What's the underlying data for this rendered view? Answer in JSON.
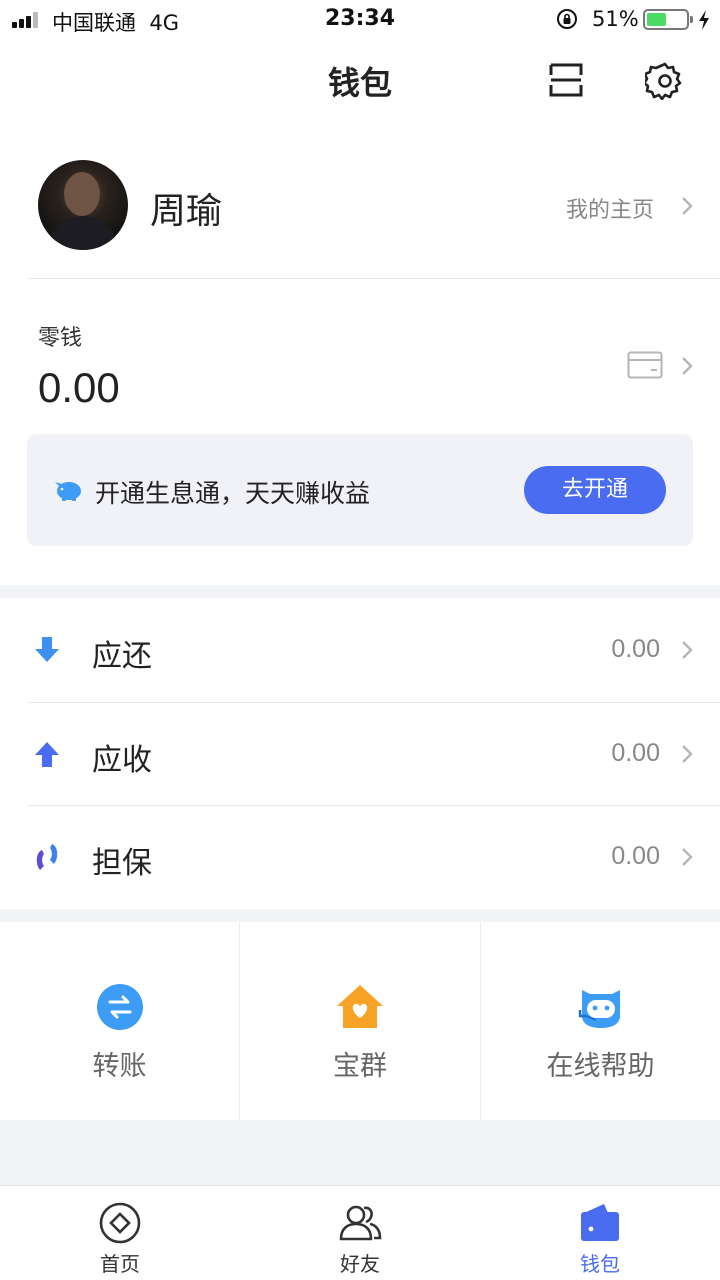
{
  "status_bar": {
    "carrier": "中国联通",
    "network": "4G",
    "time": "23:34",
    "battery_percent": "51%",
    "battery_level": 0.51
  },
  "nav": {
    "title": "钱包",
    "scan_icon": "scan-icon",
    "settings_icon": "gear-icon"
  },
  "profile": {
    "name": "周瑜",
    "homepage_link": "我的主页"
  },
  "balance": {
    "label": "零钱",
    "amount": "0.00",
    "card_icon": "bank-card-icon"
  },
  "promo": {
    "text": "开通生息通，天天赚收益",
    "button": "去开通",
    "icon": "piggy-bank-icon"
  },
  "rows": [
    {
      "label": "应还",
      "value": "0.00",
      "icon": "arrow-down-icon",
      "color": "#3d8ff2"
    },
    {
      "label": "应收",
      "value": "0.00",
      "icon": "arrow-up-icon",
      "color": "#4a6cf0"
    },
    {
      "label": "担保",
      "value": "0.00",
      "icon": "guarantee-icon",
      "color": "#5b4fd0"
    }
  ],
  "shortcuts": [
    {
      "label": "转账",
      "icon": "transfer-icon",
      "color": "#3d9cf5"
    },
    {
      "label": "宝群",
      "icon": "house-heart-icon",
      "color": "#f7a325"
    },
    {
      "label": "在线帮助",
      "icon": "robot-support-icon",
      "color": "#3d9cf5"
    }
  ],
  "tabs": [
    {
      "label": "首页",
      "icon": "home-coin-icon"
    },
    {
      "label": "好友",
      "icon": "friends-icon"
    },
    {
      "label": "钱包",
      "icon": "wallet-icon",
      "active": true
    }
  ],
  "colors": {
    "accent": "#4a6cf0",
    "page_gap": "#f3f4f8",
    "battery": "#4cd964"
  }
}
